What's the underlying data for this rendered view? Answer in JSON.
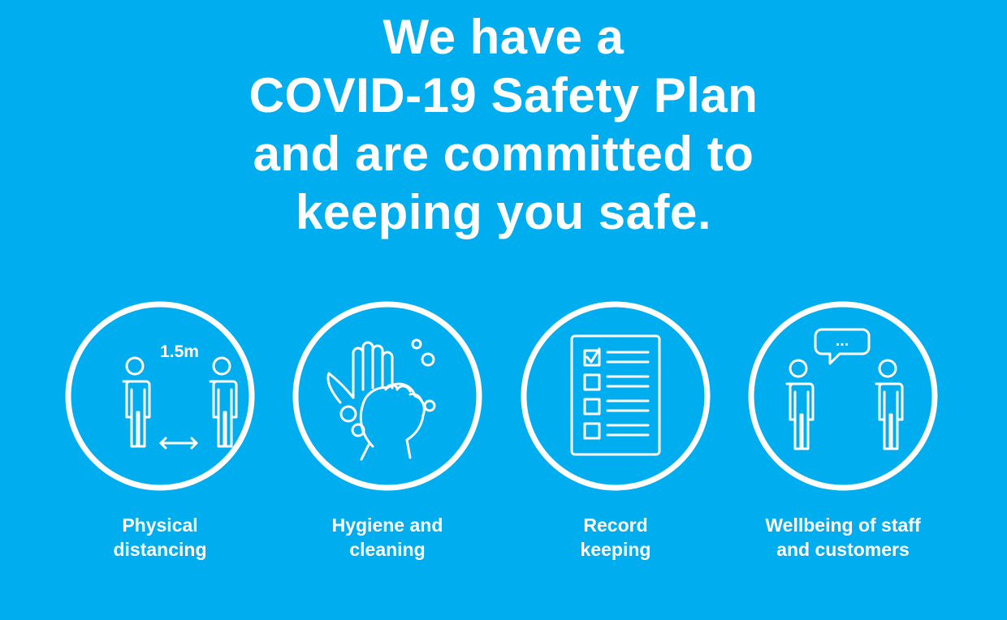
{
  "headline": {
    "line1": "We have a",
    "line2": "COVID-19 Safety Plan",
    "line3": "and are committed to",
    "line4": "keeping you safe."
  },
  "panels": [
    {
      "icon": "physical-distancing-icon",
      "distance_label": "1.5m",
      "caption_line1": "Physical",
      "caption_line2": "distancing"
    },
    {
      "icon": "hand-washing-icon",
      "caption_line1": "Hygiene and",
      "caption_line2": "cleaning"
    },
    {
      "icon": "checklist-icon",
      "caption_line1": "Record",
      "caption_line2": "keeping"
    },
    {
      "icon": "conversation-icon",
      "speech_text": "...",
      "caption_line1": "Wellbeing of staff",
      "caption_line2": "and customers"
    }
  ],
  "colors": {
    "background": "#00adef",
    "foreground": "#ffffff"
  }
}
